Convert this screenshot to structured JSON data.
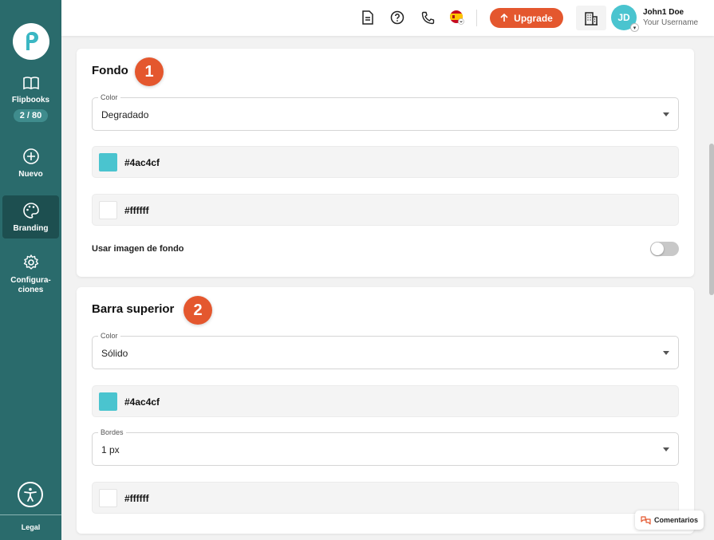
{
  "sidebar": {
    "items": [
      {
        "label": "Flipbooks",
        "icon": "book-icon",
        "badge": "2 / 80"
      },
      {
        "label": "Nuevo",
        "icon": "plus-circle-icon"
      },
      {
        "label": "Branding",
        "icon": "palette-icon"
      },
      {
        "label": "Configura-\nciones",
        "icon": "gear-icon"
      }
    ],
    "active": "Branding",
    "legal": "Legal"
  },
  "topbar": {
    "upgrade_label": "Upgrade",
    "user_name": "John1 Doe",
    "user_subtitle": "Your Username",
    "avatar_initials": "JD"
  },
  "sections": [
    {
      "step": "1",
      "title": "Fondo",
      "color_select": {
        "label": "Color",
        "value": "Degradado"
      },
      "colors": [
        {
          "hex": "#4ac4cf",
          "swatch": "#4ac4cf"
        },
        {
          "hex": "#ffffff",
          "swatch": "#ffffff"
        }
      ],
      "toggle": {
        "label": "Usar imagen de fondo",
        "on": false
      }
    },
    {
      "step": "2",
      "title": "Barra superior",
      "color_select": {
        "label": "Color",
        "value": "Sólido"
      },
      "color": {
        "hex": "#4ac4cf",
        "swatch": "#4ac4cf"
      },
      "border_select": {
        "label": "Bordes",
        "value": "1 px"
      },
      "border_color": {
        "hex": "#ffffff",
        "swatch": "#ffffff"
      }
    }
  ],
  "feedback_label": "Comentarios",
  "colors": {
    "sidebar": "#2a6b6c",
    "accent": "#e4572e",
    "brand": "#4ac4cf"
  }
}
